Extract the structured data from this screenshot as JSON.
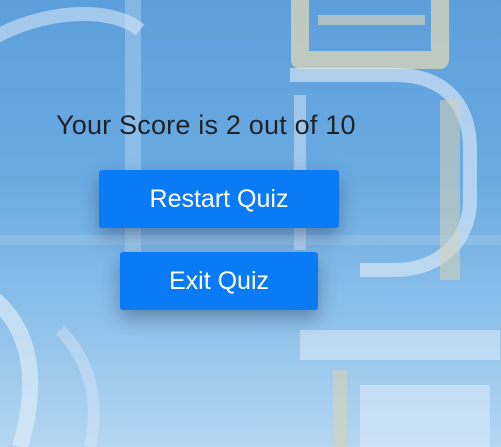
{
  "result": {
    "score_text": "Your Score is 2 out of 10"
  },
  "actions": {
    "restart_label": "Restart Quiz",
    "exit_label": "Exit Quiz"
  },
  "colors": {
    "button": "#0a7bf5",
    "button_text": "#ffffff",
    "score_text": "#1d2226",
    "background": "#6aaae2"
  }
}
